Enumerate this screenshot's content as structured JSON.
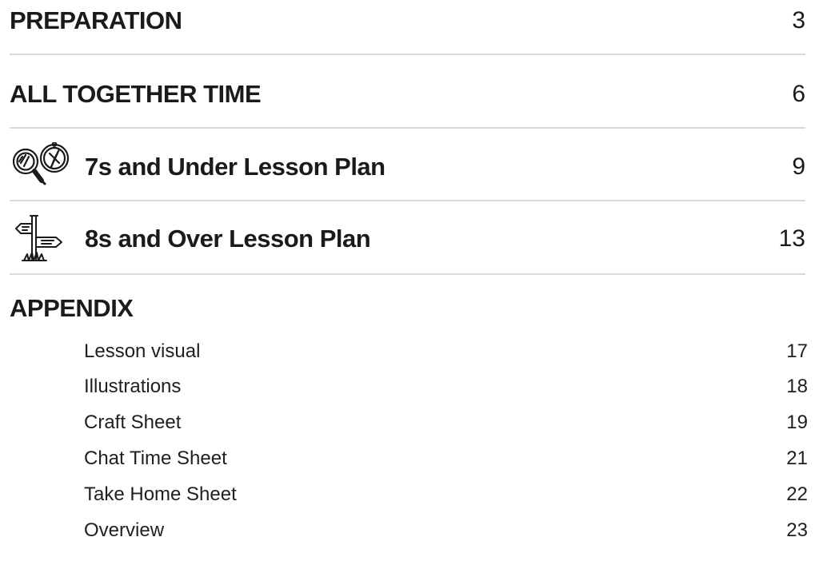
{
  "toc": {
    "sections": [
      {
        "title": "PREPARATION",
        "page": "3"
      },
      {
        "title": "ALL TOGETHER TIME",
        "page": "6"
      },
      {
        "title": "7s and Under Lesson Plan",
        "page": "9",
        "icon": "magnifier-compass-icon"
      },
      {
        "title": "8s and Over Lesson Plan",
        "page": "13",
        "icon": "signpost-icon"
      }
    ],
    "appendix": {
      "title": "APPENDIX",
      "items": [
        {
          "title": "Lesson visual",
          "page": "17"
        },
        {
          "title": "Illustrations",
          "page": "18"
        },
        {
          "title": "Craft Sheet",
          "page": "19"
        },
        {
          "title": "Chat Time Sheet",
          "page": "21"
        },
        {
          "title": "Take Home Sheet",
          "page": "22"
        },
        {
          "title": "Overview",
          "page": "23"
        }
      ]
    }
  },
  "colors": {
    "text": "#1a1a1a",
    "divider": "#d9d9d9"
  }
}
